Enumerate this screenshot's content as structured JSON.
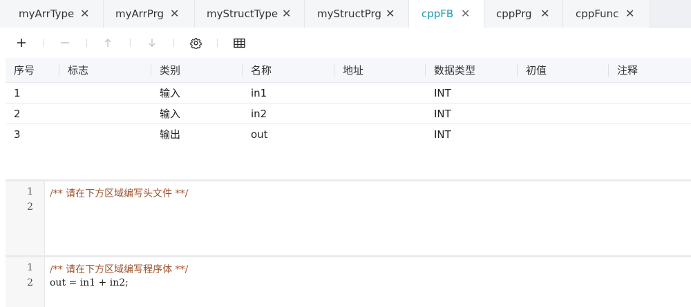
{
  "tabs": [
    {
      "label": "myArrType",
      "active": false
    },
    {
      "label": "myArrPrg",
      "active": false
    },
    {
      "label": "myStructType",
      "active": false
    },
    {
      "label": "myStructPrg",
      "active": false
    },
    {
      "label": "cppFB",
      "active": true
    },
    {
      "label": "cppPrg",
      "active": false
    },
    {
      "label": "cppFunc",
      "active": false
    }
  ],
  "tab_close_glyph": "✕",
  "toolbar": {
    "add_icon": "plus-icon",
    "remove_icon": "minus-icon",
    "move_up_icon": "arrow-up-icon",
    "move_down_icon": "arrow-down-icon",
    "settings_icon": "gear-icon",
    "table_icon": "table-icon",
    "add_glyph": "+",
    "remove_glyph": "—",
    "up_glyph": "↑",
    "down_glyph": "↓"
  },
  "table": {
    "columns": [
      "序号",
      "标志",
      "类别",
      "名称",
      "地址",
      "数据类型",
      "初值",
      "注释"
    ],
    "rows": [
      [
        "1",
        "",
        "输入",
        "in1",
        "",
        "INT",
        "",
        ""
      ],
      [
        "2",
        "",
        "输入",
        "in2",
        "",
        "INT",
        "",
        ""
      ],
      [
        "3",
        "",
        "输出",
        "out",
        "",
        "INT",
        "",
        ""
      ]
    ]
  },
  "header_editor": {
    "lines": [
      "/** 请在下方区域编写头文件 **/",
      ""
    ],
    "line_numbers": [
      "1",
      "2"
    ]
  },
  "body_editor": {
    "lines": [
      "/** 请在下方区域编写程序体 **/",
      "out = in1 + in2;"
    ],
    "line_numbers": [
      "1",
      "2"
    ]
  },
  "colors": {
    "active_tab": "#1b9aaa",
    "comment": "#a0522d"
  }
}
